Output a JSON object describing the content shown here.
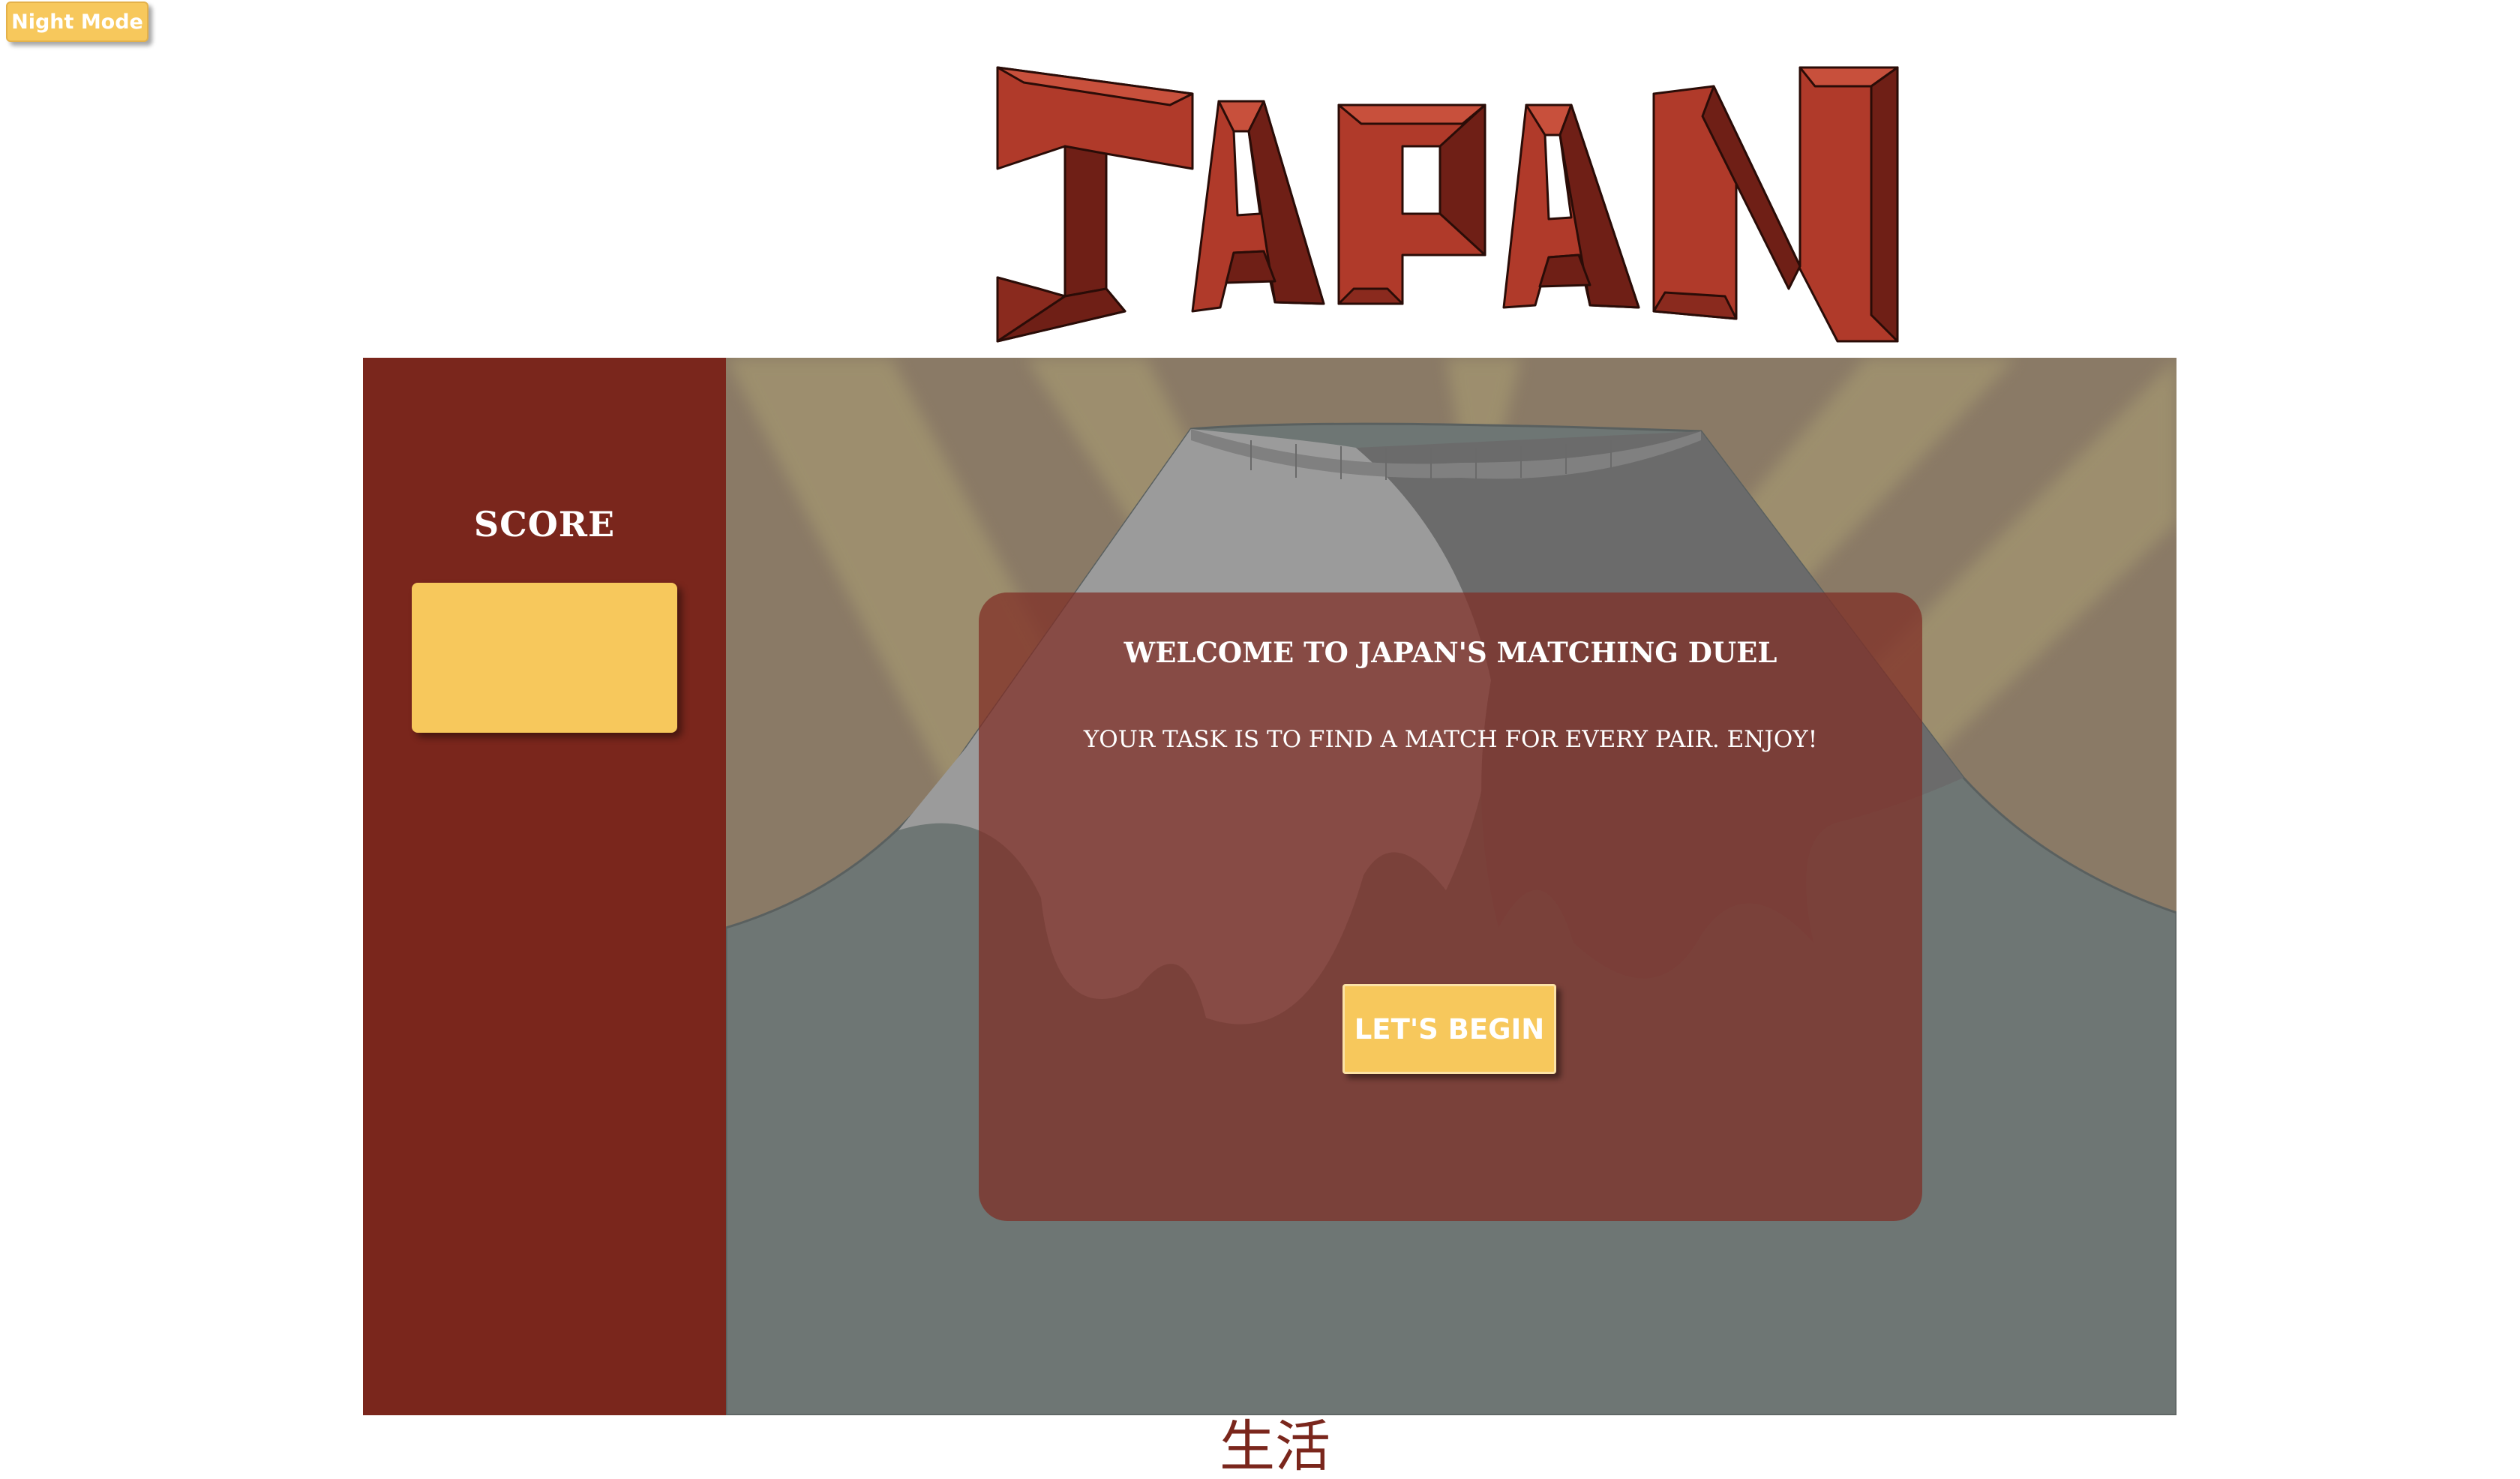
{
  "header": {
    "night_mode_label": "Night Mode",
    "logo_text": "JAPAN"
  },
  "score_panel": {
    "label": "SCORE",
    "value": ""
  },
  "welcome": {
    "title": "WELCOME TO JAPAN'S MATCHING DUEL",
    "subtitle": "YOUR TASK IS TO FIND A MATCH FOR EVERY PAIR. ENJOY!",
    "begin_label": "LET'S BEGIN"
  },
  "footer": {
    "kanji": "生活"
  },
  "colors": {
    "accent_yellow": "#f7c85c",
    "brand_red": "#7a261c",
    "logo_red": "#b03a2a",
    "sky_tan": "#8a7a66",
    "mountain_grey": "#6e7674"
  }
}
